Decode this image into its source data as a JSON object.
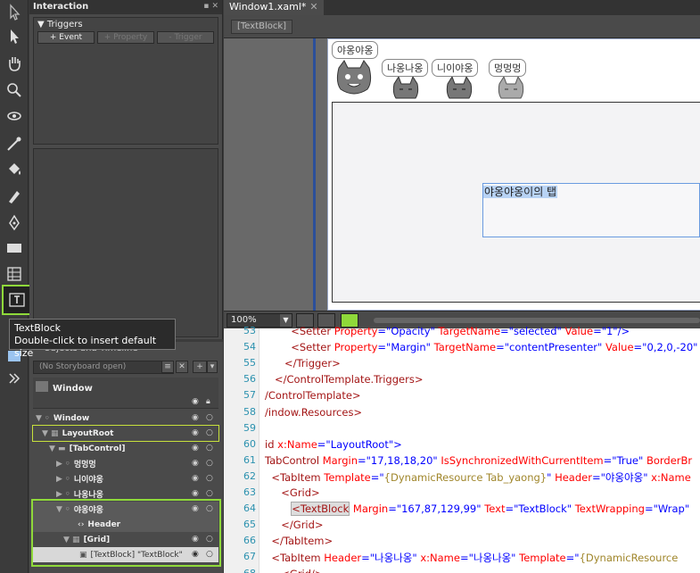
{
  "interaction": {
    "title": "Interaction",
    "triggers_label": "Triggers",
    "btn_event": "+ Event",
    "btn_property": "+ Property",
    "btn_trigger": "- Trigger"
  },
  "objects": {
    "title": "Objects and Timeline",
    "storyboard_placeholder": "(No Storyboard open)",
    "root_label": "Window",
    "tree": [
      {
        "label": "Window",
        "indent": 0
      },
      {
        "label": "LayoutRoot",
        "indent": 1
      },
      {
        "label": "[TabControl]",
        "indent": 2
      },
      {
        "label": "멍멍멍",
        "indent": 3
      },
      {
        "label": "니이야옹",
        "indent": 3
      },
      {
        "label": "나옹나옹",
        "indent": 3
      },
      {
        "label": "야옹야옹",
        "indent": 3
      },
      {
        "label": "Header",
        "indent": 4
      },
      {
        "label": "[Grid]",
        "indent": 4
      },
      {
        "label": "[TextBlock] \"TextBlock\"",
        "indent": 5
      }
    ]
  },
  "tooltip": {
    "title": "TextBlock",
    "hint": "Double-click to insert default size"
  },
  "document": {
    "tab_title": "Window1.xaml*",
    "breadcrumb": "[TextBlock]",
    "zoom": "100%"
  },
  "artboard": {
    "tabs": [
      "야옹야옹",
      "나옹나옹",
      "니이야옹",
      "멍멍멍"
    ],
    "textblock_text": "야옹야옹이의 탭"
  },
  "editor": {
    "lines": [
      {
        "n": "53",
        "segs": [
          [
            "        ",
            ""
          ],
          [
            "<Setter ",
            "tag"
          ],
          [
            "Property",
            "attr"
          ],
          [
            "=\"Opacity\" ",
            "val"
          ],
          [
            "TargetName",
            "attr"
          ],
          [
            "=\"selected\" ",
            "val"
          ],
          [
            "Value",
            "attr"
          ],
          [
            "=\"1\"/>",
            "val"
          ]
        ]
      },
      {
        "n": "54",
        "segs": [
          [
            "        ",
            ""
          ],
          [
            "<Setter ",
            "tag"
          ],
          [
            "Property",
            "attr"
          ],
          [
            "=\"Margin\" ",
            "val"
          ],
          [
            "TargetName",
            "attr"
          ],
          [
            "=\"contentPresenter\" ",
            "val"
          ],
          [
            "Value",
            "attr"
          ],
          [
            "=\"0,2,0,-20\"",
            "val"
          ]
        ]
      },
      {
        "n": "55",
        "segs": [
          [
            "      ",
            ""
          ],
          [
            "</Trigger>",
            "tag"
          ]
        ]
      },
      {
        "n": "56",
        "segs": [
          [
            "   ",
            ""
          ],
          [
            "</ControlTemplate.Triggers>",
            "tag"
          ]
        ]
      },
      {
        "n": "57",
        "segs": [
          [
            "",
            ""
          ],
          [
            "/ControlTemplate>",
            "tag"
          ]
        ]
      },
      {
        "n": "58",
        "segs": [
          [
            "",
            ""
          ],
          [
            "/indow.Resources>",
            "tag"
          ]
        ]
      },
      {
        "n": "59",
        "segs": [
          [
            "",
            ""
          ]
        ]
      },
      {
        "n": "60",
        "segs": [
          [
            "",
            ""
          ],
          [
            "id ",
            "tag"
          ],
          [
            "x:Name",
            "attr"
          ],
          [
            "=\"LayoutRoot\">",
            "val"
          ]
        ]
      },
      {
        "n": "61",
        "segs": [
          [
            "",
            ""
          ],
          [
            "TabControl ",
            "tag"
          ],
          [
            "Margin",
            "attr"
          ],
          [
            "=\"17,18,18,20\" ",
            "val"
          ],
          [
            "IsSynchronizedWithCurrentItem",
            "attr"
          ],
          [
            "=\"True\" ",
            "val"
          ],
          [
            "BorderBr",
            "attr"
          ]
        ]
      },
      {
        "n": "62",
        "segs": [
          [
            "  ",
            ""
          ],
          [
            "<TabItem ",
            "tag"
          ],
          [
            "Template",
            "attr"
          ],
          [
            "=\"",
            "val"
          ],
          [
            "{DynamicResource Tab_yaong}",
            "ext"
          ],
          [
            "\" ",
            "val"
          ],
          [
            "Header",
            "attr"
          ],
          [
            "=\"야옹야옹\" ",
            "val"
          ],
          [
            "x:Name",
            "attr"
          ]
        ]
      },
      {
        "n": "63",
        "segs": [
          [
            "     ",
            ""
          ],
          [
            "<Grid>",
            "tag"
          ]
        ]
      },
      {
        "n": "64",
        "segs": [
          [
            "        ",
            ""
          ],
          [
            "<TextBlock",
            "tag hi"
          ],
          [
            " Margin",
            "attr"
          ],
          [
            "=\"167,87,129,99\" ",
            "val"
          ],
          [
            "Text",
            "attr"
          ],
          [
            "=\"TextBlock\" ",
            "val"
          ],
          [
            "TextWrapping",
            "attr"
          ],
          [
            "=\"Wrap\"",
            "val"
          ]
        ]
      },
      {
        "n": "65",
        "segs": [
          [
            "     ",
            ""
          ],
          [
            "</Grid>",
            "tag"
          ]
        ]
      },
      {
        "n": "66",
        "segs": [
          [
            "  ",
            ""
          ],
          [
            "</TabItem>",
            "tag"
          ]
        ]
      },
      {
        "n": "67",
        "segs": [
          [
            "  ",
            ""
          ],
          [
            "<TabItem ",
            "tag"
          ],
          [
            "Header",
            "attr"
          ],
          [
            "=\"나옹나옹\" ",
            "val"
          ],
          [
            "x:Name",
            "attr"
          ],
          [
            "=\"나옹나옹\" ",
            "val"
          ],
          [
            "Template",
            "attr"
          ],
          [
            "=\"",
            "val"
          ],
          [
            "{DynamicResource",
            "ext"
          ]
        ]
      },
      {
        "n": "68",
        "segs": [
          [
            "     ",
            ""
          ],
          [
            "<Grid/>",
            "tag"
          ]
        ]
      }
    ]
  }
}
